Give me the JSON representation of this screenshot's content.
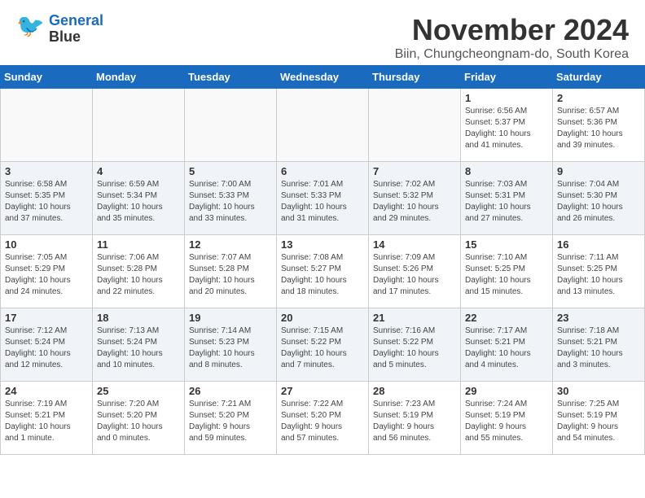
{
  "header": {
    "logo_line1": "General",
    "logo_line2": "Blue",
    "month_title": "November 2024",
    "location": "Biin, Chungcheongnam-do, South Korea"
  },
  "weekdays": [
    "Sunday",
    "Monday",
    "Tuesday",
    "Wednesday",
    "Thursday",
    "Friday",
    "Saturday"
  ],
  "weeks": [
    [
      {
        "day": "",
        "info": "",
        "empty": true
      },
      {
        "day": "",
        "info": "",
        "empty": true
      },
      {
        "day": "",
        "info": "",
        "empty": true
      },
      {
        "day": "",
        "info": "",
        "empty": true
      },
      {
        "day": "",
        "info": "",
        "empty": true
      },
      {
        "day": "1",
        "info": "Sunrise: 6:56 AM\nSunset: 5:37 PM\nDaylight: 10 hours\nand 41 minutes.",
        "empty": false
      },
      {
        "day": "2",
        "info": "Sunrise: 6:57 AM\nSunset: 5:36 PM\nDaylight: 10 hours\nand 39 minutes.",
        "empty": false
      }
    ],
    [
      {
        "day": "3",
        "info": "Sunrise: 6:58 AM\nSunset: 5:35 PM\nDaylight: 10 hours\nand 37 minutes.",
        "empty": false
      },
      {
        "day": "4",
        "info": "Sunrise: 6:59 AM\nSunset: 5:34 PM\nDaylight: 10 hours\nand 35 minutes.",
        "empty": false
      },
      {
        "day": "5",
        "info": "Sunrise: 7:00 AM\nSunset: 5:33 PM\nDaylight: 10 hours\nand 33 minutes.",
        "empty": false
      },
      {
        "day": "6",
        "info": "Sunrise: 7:01 AM\nSunset: 5:33 PM\nDaylight: 10 hours\nand 31 minutes.",
        "empty": false
      },
      {
        "day": "7",
        "info": "Sunrise: 7:02 AM\nSunset: 5:32 PM\nDaylight: 10 hours\nand 29 minutes.",
        "empty": false
      },
      {
        "day": "8",
        "info": "Sunrise: 7:03 AM\nSunset: 5:31 PM\nDaylight: 10 hours\nand 27 minutes.",
        "empty": false
      },
      {
        "day": "9",
        "info": "Sunrise: 7:04 AM\nSunset: 5:30 PM\nDaylight: 10 hours\nand 26 minutes.",
        "empty": false
      }
    ],
    [
      {
        "day": "10",
        "info": "Sunrise: 7:05 AM\nSunset: 5:29 PM\nDaylight: 10 hours\nand 24 minutes.",
        "empty": false
      },
      {
        "day": "11",
        "info": "Sunrise: 7:06 AM\nSunset: 5:28 PM\nDaylight: 10 hours\nand 22 minutes.",
        "empty": false
      },
      {
        "day": "12",
        "info": "Sunrise: 7:07 AM\nSunset: 5:28 PM\nDaylight: 10 hours\nand 20 minutes.",
        "empty": false
      },
      {
        "day": "13",
        "info": "Sunrise: 7:08 AM\nSunset: 5:27 PM\nDaylight: 10 hours\nand 18 minutes.",
        "empty": false
      },
      {
        "day": "14",
        "info": "Sunrise: 7:09 AM\nSunset: 5:26 PM\nDaylight: 10 hours\nand 17 minutes.",
        "empty": false
      },
      {
        "day": "15",
        "info": "Sunrise: 7:10 AM\nSunset: 5:25 PM\nDaylight: 10 hours\nand 15 minutes.",
        "empty": false
      },
      {
        "day": "16",
        "info": "Sunrise: 7:11 AM\nSunset: 5:25 PM\nDaylight: 10 hours\nand 13 minutes.",
        "empty": false
      }
    ],
    [
      {
        "day": "17",
        "info": "Sunrise: 7:12 AM\nSunset: 5:24 PM\nDaylight: 10 hours\nand 12 minutes.",
        "empty": false
      },
      {
        "day": "18",
        "info": "Sunrise: 7:13 AM\nSunset: 5:24 PM\nDaylight: 10 hours\nand 10 minutes.",
        "empty": false
      },
      {
        "day": "19",
        "info": "Sunrise: 7:14 AM\nSunset: 5:23 PM\nDaylight: 10 hours\nand 8 minutes.",
        "empty": false
      },
      {
        "day": "20",
        "info": "Sunrise: 7:15 AM\nSunset: 5:22 PM\nDaylight: 10 hours\nand 7 minutes.",
        "empty": false
      },
      {
        "day": "21",
        "info": "Sunrise: 7:16 AM\nSunset: 5:22 PM\nDaylight: 10 hours\nand 5 minutes.",
        "empty": false
      },
      {
        "day": "22",
        "info": "Sunrise: 7:17 AM\nSunset: 5:21 PM\nDaylight: 10 hours\nand 4 minutes.",
        "empty": false
      },
      {
        "day": "23",
        "info": "Sunrise: 7:18 AM\nSunset: 5:21 PM\nDaylight: 10 hours\nand 3 minutes.",
        "empty": false
      }
    ],
    [
      {
        "day": "24",
        "info": "Sunrise: 7:19 AM\nSunset: 5:21 PM\nDaylight: 10 hours\nand 1 minute.",
        "empty": false
      },
      {
        "day": "25",
        "info": "Sunrise: 7:20 AM\nSunset: 5:20 PM\nDaylight: 10 hours\nand 0 minutes.",
        "empty": false
      },
      {
        "day": "26",
        "info": "Sunrise: 7:21 AM\nSunset: 5:20 PM\nDaylight: 9 hours\nand 59 minutes.",
        "empty": false
      },
      {
        "day": "27",
        "info": "Sunrise: 7:22 AM\nSunset: 5:20 PM\nDaylight: 9 hours\nand 57 minutes.",
        "empty": false
      },
      {
        "day": "28",
        "info": "Sunrise: 7:23 AM\nSunset: 5:19 PM\nDaylight: 9 hours\nand 56 minutes.",
        "empty": false
      },
      {
        "day": "29",
        "info": "Sunrise: 7:24 AM\nSunset: 5:19 PM\nDaylight: 9 hours\nand 55 minutes.",
        "empty": false
      },
      {
        "day": "30",
        "info": "Sunrise: 7:25 AM\nSunset: 5:19 PM\nDaylight: 9 hours\nand 54 minutes.",
        "empty": false
      }
    ]
  ]
}
